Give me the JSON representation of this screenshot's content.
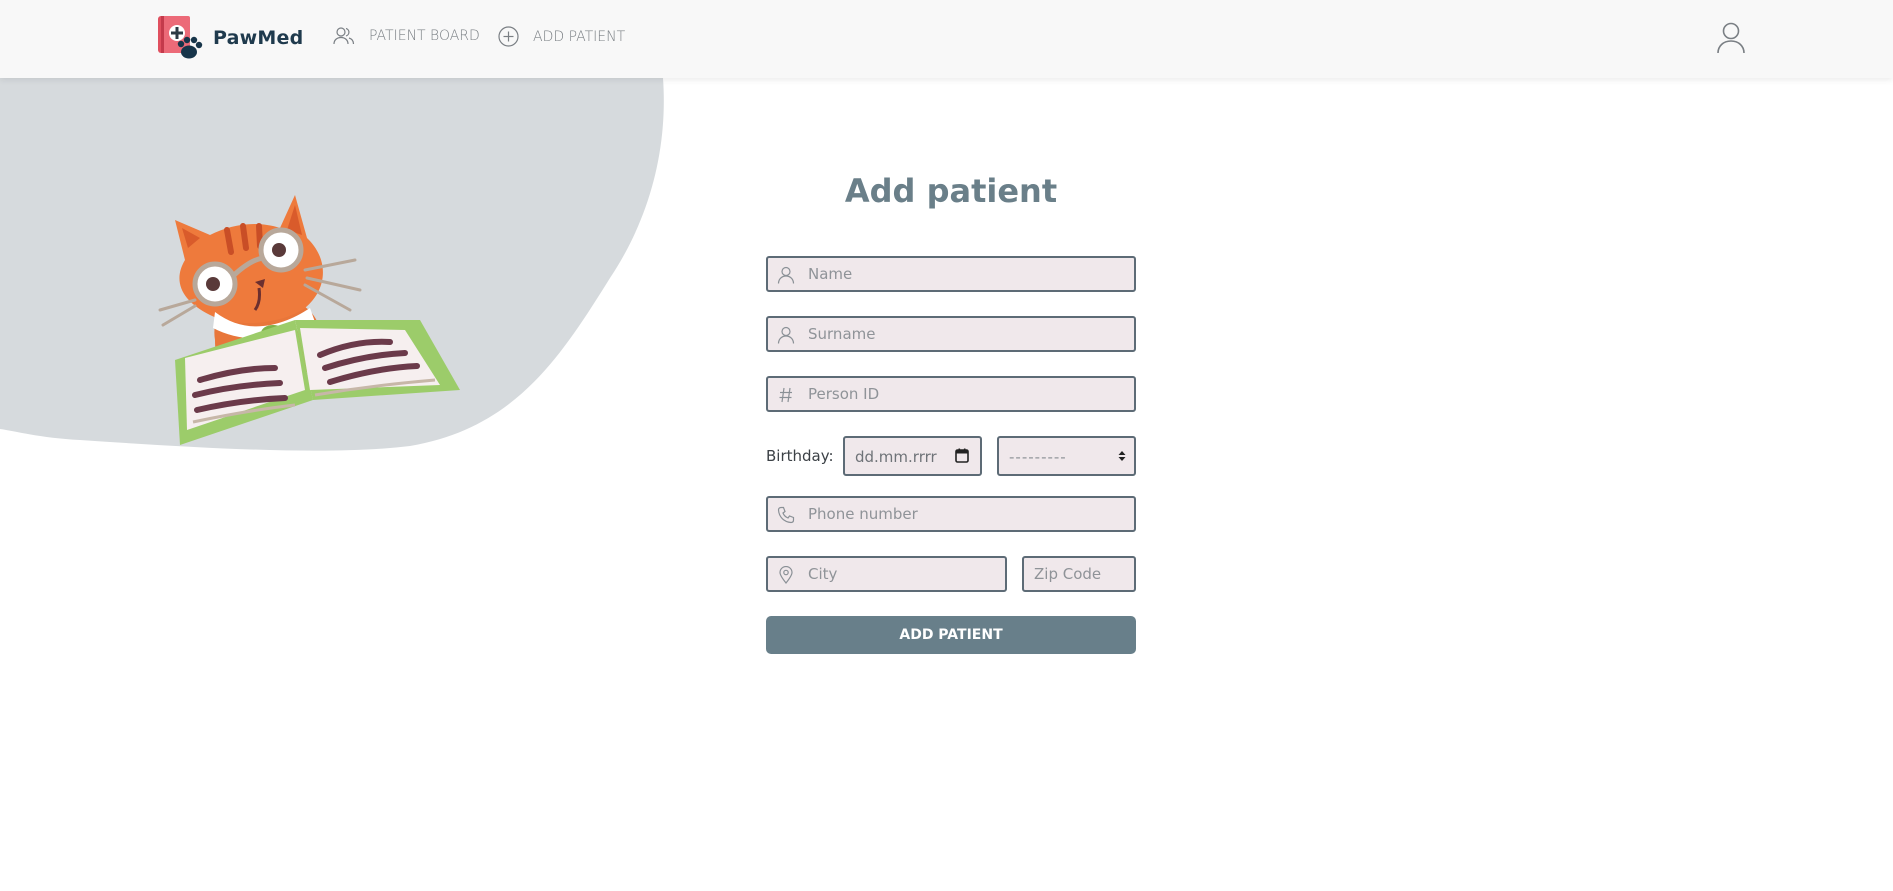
{
  "navbar": {
    "brand": "PawMed",
    "links": [
      {
        "label": "PATIENT BOARD",
        "icon": "users-icon"
      },
      {
        "label": "ADD PATIENT",
        "icon": "plus-circle-icon"
      }
    ],
    "account_icon": "user-icon"
  },
  "form": {
    "title": "Add patient",
    "name_placeholder": "Name",
    "surname_placeholder": "Surname",
    "person_id_placeholder": "Person ID",
    "birthday_label": "Birthday:",
    "birthday_date_value": "dd.mm.rrrr",
    "birthday_select_value": "---------",
    "phone_placeholder": "Phone number",
    "city_placeholder": "City",
    "zip_placeholder": "Zip Code",
    "submit_label": "ADD PATIENT"
  },
  "colors": {
    "navbar_bg": "#f8f8f8",
    "brand_text": "#1f3a4d",
    "title": "#6a7f89",
    "input_bg": "#f0e8eb",
    "input_border": "#5d6b76",
    "button_bg": "#687f8a",
    "blob": "#d6dadd"
  }
}
